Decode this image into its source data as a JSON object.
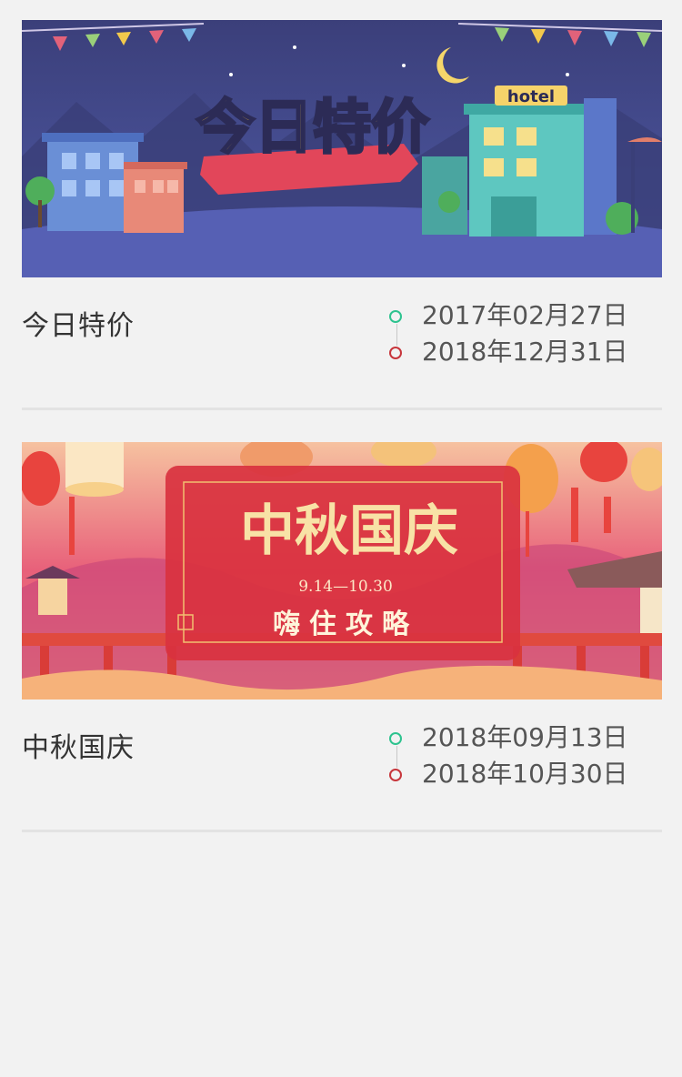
{
  "promotions": [
    {
      "title": "今日特价",
      "start_date": "2017年02月27日",
      "end_date": "2018年12月31日",
      "banner": {
        "headline": "今日特价",
        "sign": "hotel",
        "icon": "hotel-night-illustration"
      }
    },
    {
      "title": "中秋国庆",
      "start_date": "2018年09月13日",
      "end_date": "2018年10月30日",
      "banner": {
        "headline": "中秋国庆",
        "date_range": "9.14—10.30",
        "subtitle": "嗨住攻略",
        "icon": "lantern-festival-illustration"
      }
    }
  ],
  "colors": {
    "start_dot": "#2ec38f",
    "end_dot": "#c7353b",
    "background": "#f2f2f2"
  }
}
